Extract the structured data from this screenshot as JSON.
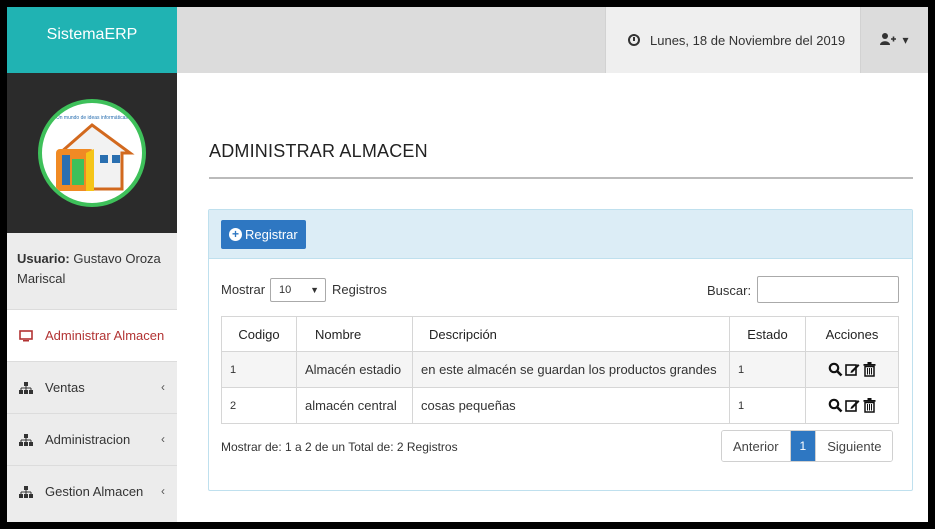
{
  "app": {
    "brand": "SistemaERP"
  },
  "logo": {
    "tagline": "Un mundo de ideas informáticas"
  },
  "topbar": {
    "date": "Lunes, 18 de Noviembre del 2019"
  },
  "user": {
    "label": "Usuario:",
    "name": "Gustavo Oroza Mariscal"
  },
  "sidebar": {
    "items": [
      {
        "label": "Administrar Almacen",
        "icon": "monitor-icon",
        "active": true
      },
      {
        "label": "Ventas",
        "icon": "sitemap-icon",
        "has_children": true
      },
      {
        "label": "Administracion",
        "icon": "sitemap-icon",
        "has_children": true
      },
      {
        "label": "Gestion Almacen",
        "icon": "sitemap-icon",
        "has_children": true
      }
    ]
  },
  "page": {
    "title": "ADMINISTRAR ALMACEN"
  },
  "panel": {
    "register_label": "Registrar",
    "show_label": "Mostrar",
    "page_length": "10",
    "records_label": "Registros",
    "search_label": "Buscar:",
    "search_value": ""
  },
  "table": {
    "headers": [
      "Codigo",
      "Nombre",
      "Descripción",
      "Estado",
      "Acciones"
    ],
    "rows": [
      {
        "codigo": "1",
        "nombre": "Almacén estadio",
        "descripcion": "en este almacén se guardan los productos grandes",
        "estado": "1"
      },
      {
        "codigo": "2",
        "nombre": "almacén central",
        "descripcion": "cosas pequeñas",
        "estado": "1"
      }
    ]
  },
  "footer": {
    "info": "Mostrar de: 1 a 2 de un Total de: 2 Registros",
    "prev_label": "Anterior",
    "current_page": "1",
    "next_label": "Siguiente"
  },
  "colors": {
    "brand": "#20b3b3",
    "primary": "#2e77c2",
    "active_menu": "#b23333"
  }
}
